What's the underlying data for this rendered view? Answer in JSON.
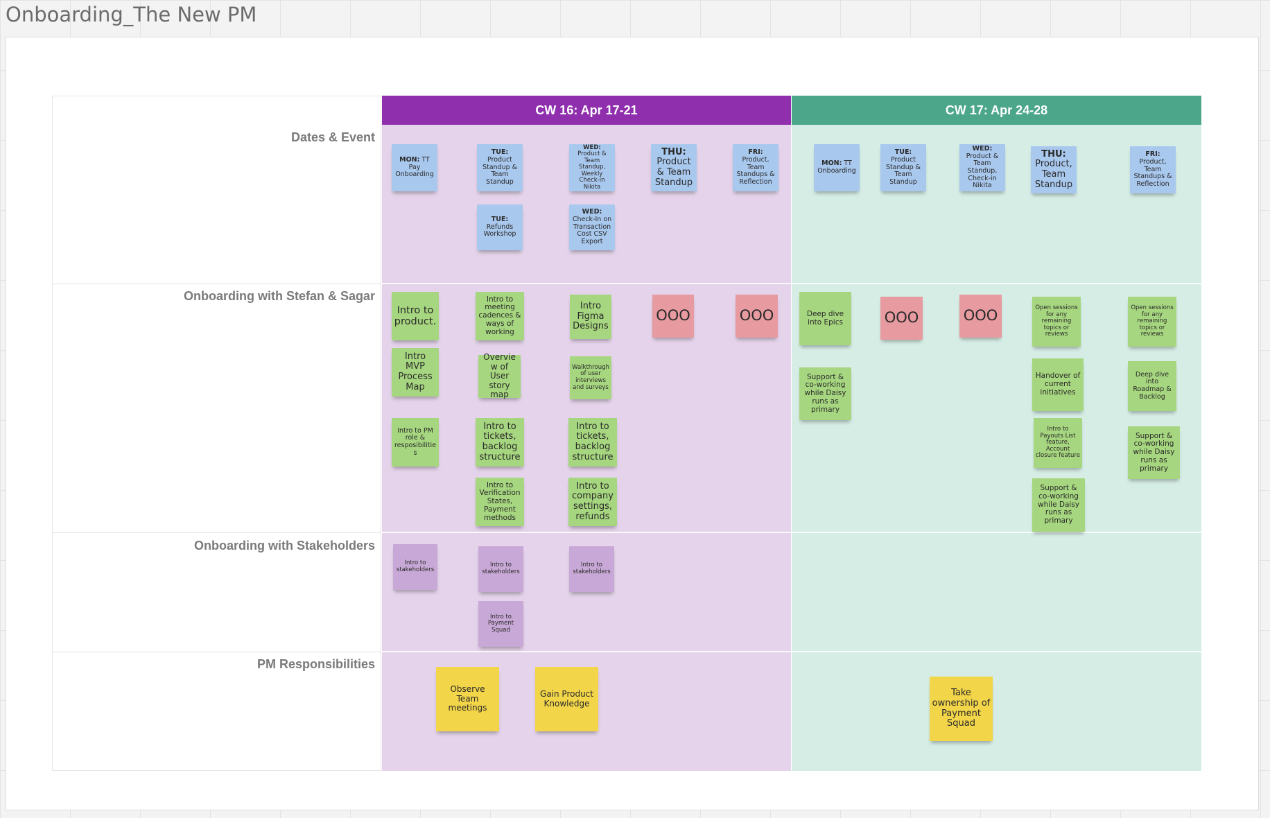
{
  "board": {
    "title": "Onboarding_The New PM"
  },
  "weeks": [
    {
      "label": "CW 16: Apr 17-21",
      "header_color": "#8f2fad",
      "body_color": "#e4d3ea"
    },
    {
      "label": "CW 17: Apr 24-28",
      "header_color": "#4ba68a",
      "body_color": "#d6ede6"
    }
  ],
  "rows": [
    {
      "label": "Dates & Event"
    },
    {
      "label": "Onboarding with Stefan & Sagar"
    },
    {
      "label": "Onboarding with Stakeholders"
    },
    {
      "label": "PM Responsibilities"
    }
  ],
  "note_colors": {
    "event": "#a9c8ee",
    "session": "#a6d67f",
    "ooo": "#e79aa0",
    "stakeholder": "#c8a8d6",
    "responsibility": "#f2d549"
  },
  "notes": {
    "d1": {
      "day": "MON:",
      "text": " TT Pay Onboarding"
    },
    "d2": {
      "day": "TUE:",
      "text": " Product Standup & Team Standup"
    },
    "d3": {
      "day": "WED:",
      "text": " Product & Team Standup, Weekly Check-in Nikita"
    },
    "d4": {
      "day": "THU:",
      "text": " Product & Team Standup"
    },
    "d5": {
      "day": "FRI:",
      "text": " Product, Team Standups & Reflection"
    },
    "d6": {
      "day": "TUE:",
      "text": " Refunds Workshop"
    },
    "d7": {
      "day": "WED:",
      "text": " Check-In on Transaction Cost CSV Export"
    },
    "d8": {
      "day": "MON:",
      "text": " TT Onboarding"
    },
    "d9": {
      "day": "TUE:",
      "text": " Product Standup & Team Standup"
    },
    "d10": {
      "day": "WED:",
      "text": " Product & Team Standup, Check-in Nikita"
    },
    "d11": {
      "day": "THU:",
      "text": " Product, Team Standup"
    },
    "d12": {
      "day": "FRI:",
      "text": " Product, Team Standups & Reflection"
    },
    "s1": "Intro to product.",
    "s2": "Intro to meeting cadences & ways of working",
    "s3": "Intro Figma Designs",
    "s4": "OOO",
    "s5": "OOO",
    "s6": "Intro MVP Process Map",
    "s7": "Overview of User story map",
    "s8": "Walkthrough of user interviews and surveys",
    "s9": "Intro to PM role & resposibilities",
    "s10": "Intro to tickets, backlog structure",
    "s11": "Intro to tickets, backlog structure",
    "s12": "Intro to Verification States, Payment methods",
    "s13": "Intro to company settings, refunds",
    "s14": "Deep dive into Epics",
    "s15": "OOO",
    "s16": "OOO",
    "s17": "Open sessions for any remaining topics or reviews",
    "s18": "Open sessions for any remaining topics or reviews",
    "s19": "Support & co-working while Daisy runs as primary",
    "s20": "Handover of current initiatives",
    "s21": "Deep dive into Roadmap & Backlog",
    "s22": "Intro to Payouts List feature, Account closure feature",
    "s23": "Support & co-working while Daisy runs as primary",
    "s24": "Support & co-working while Daisy runs as primary",
    "k1": "Intro to stakeholders",
    "k2": "Intro to stakeholders",
    "k3": "Intro to stakeholders",
    "k4": "Intro to Payment Squad",
    "p1": "Observe Team meetings",
    "p2": "Gain Product Knowledge",
    "p3": "Take ownership of Payment Squad"
  }
}
